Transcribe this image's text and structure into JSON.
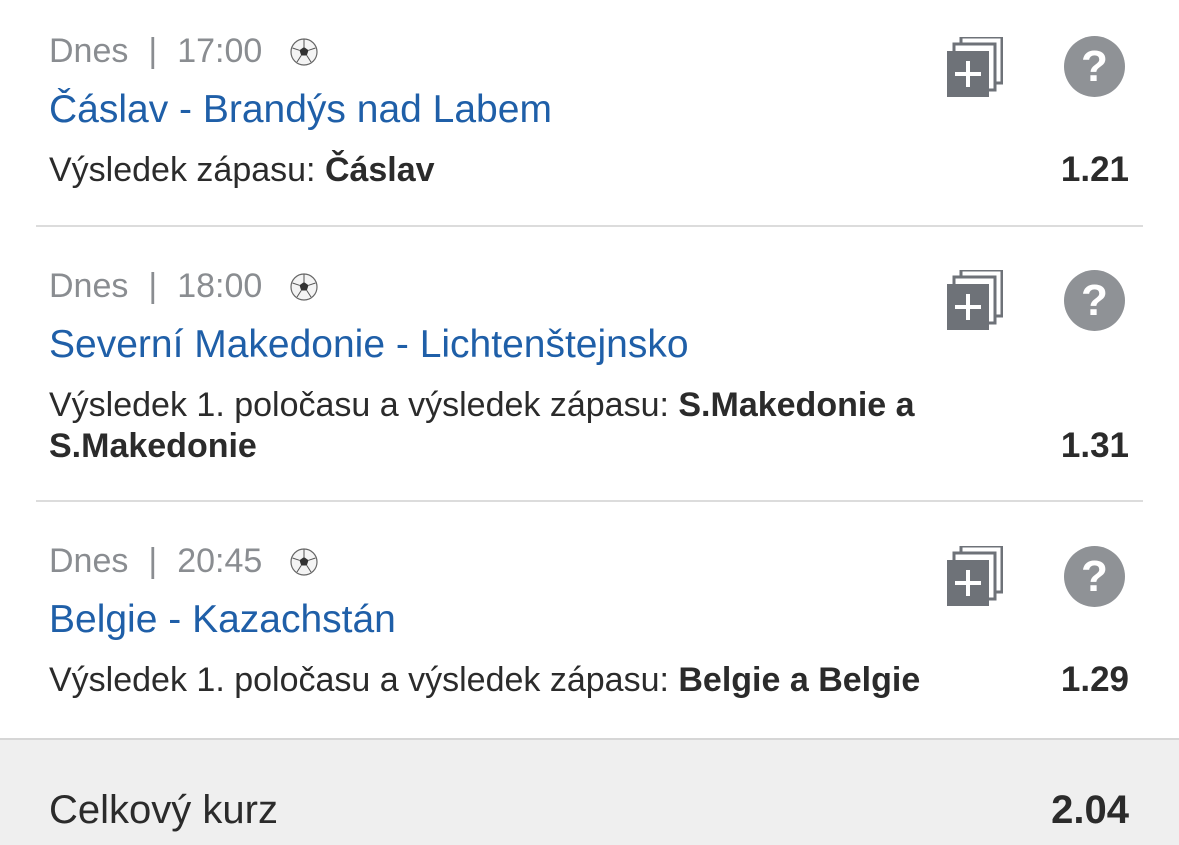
{
  "bets": [
    {
      "day": "Dnes",
      "separator": "|",
      "time": "17:00",
      "sport_icon": "soccer-ball-icon",
      "match": "Čáslav - Brandýs nad Labem",
      "market": "Výsledek zápasu: ",
      "pick": "Čáslav",
      "odds": "1.21"
    },
    {
      "day": "Dnes",
      "separator": "|",
      "time": "18:00",
      "sport_icon": "soccer-ball-icon",
      "match": "Severní Makedonie - Lichtenštejnsko",
      "market": "Výsledek 1. poločasu a výsledek zápasu: ",
      "pick": "S.Makedonie a S.Makedonie",
      "odds": "1.31"
    },
    {
      "day": "Dnes",
      "separator": "|",
      "time": "20:45",
      "sport_icon": "soccer-ball-icon",
      "match": "Belgie - Kazachstán",
      "market": "Výsledek 1. poločasu a výsledek zápasu: ",
      "pick": "Belgie a Belgie",
      "odds": "1.29"
    }
  ],
  "actions": {
    "copy_icon": "add-to-ticket-icon",
    "help_icon": "question-mark-icon",
    "help_glyph": "?"
  },
  "summary": {
    "label": "Celkový kurz",
    "value": "2.04"
  },
  "colors": {
    "link_blue": "#1f5fa8",
    "meta_gray": "#8a8d91",
    "icon_gray": "#8f9296",
    "copy_icon": "#6e7278",
    "footer_bg": "#efefef"
  }
}
